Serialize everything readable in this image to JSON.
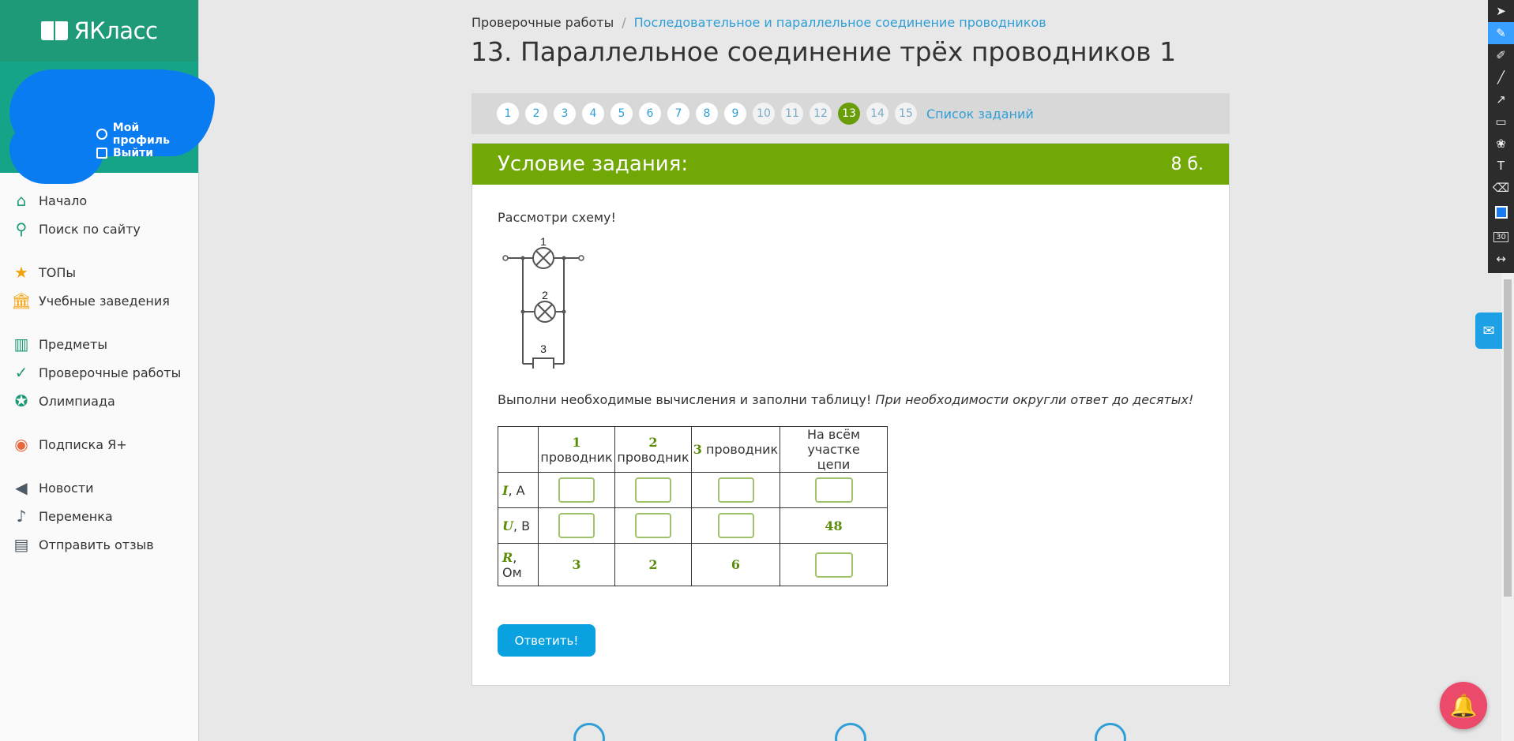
{
  "brand": {
    "name": "ЯКласс"
  },
  "profile": {
    "my_profile": "Мой профиль",
    "logout": "Выйти"
  },
  "sidebar": {
    "groups": [
      [
        {
          "label": "Начало",
          "icon": "home-icon"
        },
        {
          "label": "Поиск по сайту",
          "icon": "search-icon"
        }
      ],
      [
        {
          "label": "ТОПы",
          "icon": "star-icon"
        },
        {
          "label": "Учебные заведения",
          "icon": "school-icon"
        }
      ],
      [
        {
          "label": "Предметы",
          "icon": "books-icon"
        },
        {
          "label": "Проверочные работы",
          "icon": "check-circle-icon"
        },
        {
          "label": "Олимпиада",
          "icon": "medal-icon"
        }
      ],
      [
        {
          "label": "Подписка Я+",
          "icon": "subscription-icon"
        }
      ],
      [
        {
          "label": "Новости",
          "icon": "megaphone-icon"
        },
        {
          "label": "Переменка",
          "icon": "bell-icon"
        },
        {
          "label": "Отправить отзыв",
          "icon": "feedback-icon"
        }
      ]
    ]
  },
  "breadcrumb": {
    "root": "Проверочные работы",
    "separator": "/",
    "current": "Последовательное и параллельное соединение проводников"
  },
  "page": {
    "title": "13. Параллельное соединение трёх проводников 1"
  },
  "pager": {
    "items": [
      "1",
      "2",
      "3",
      "4",
      "5",
      "6",
      "7",
      "8",
      "9",
      "10",
      "11",
      "12",
      "13",
      "14",
      "15"
    ],
    "active": "13",
    "list_label": "Список заданий"
  },
  "task": {
    "header": "Условие задания:",
    "points": "8 б.",
    "intro": "Рассмотри схему!",
    "circuit_labels": [
      "1",
      "2",
      "3"
    ],
    "instruction": "Выполни необходимые вычисления и заполни таблицу!",
    "instruction_italic": "При необходимости округли ответ до десятых!",
    "table": {
      "headers": [
        {
          "num": "1",
          "text": "проводник"
        },
        {
          "num": "2",
          "text": "проводник"
        },
        {
          "num": "3",
          "text": "проводник"
        },
        {
          "num": "",
          "text": "На всём участке цепи"
        }
      ],
      "rows": [
        {
          "var": "I",
          "unit": ", А",
          "cells": [
            "",
            "",
            "",
            ""
          ]
        },
        {
          "var": "U",
          "unit": ", В",
          "cells": [
            "",
            "",
            "",
            "48"
          ]
        },
        {
          "var": "R",
          "unit": ",",
          "unit2": "Ом",
          "cells": [
            "3",
            "2",
            "6",
            ""
          ]
        }
      ]
    },
    "submit": "Ответить!"
  },
  "toolbar": {
    "size": "30"
  },
  "colors": {
    "brand": "#1f9a78",
    "accent": "#71a806",
    "link": "#2f9fd6",
    "button": "#0aa1e0"
  }
}
